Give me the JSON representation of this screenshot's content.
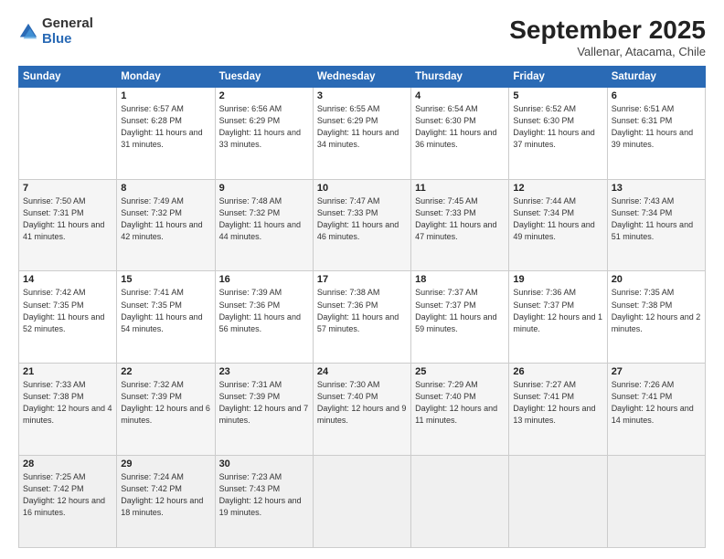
{
  "logo": {
    "general": "General",
    "blue": "Blue"
  },
  "title": "September 2025",
  "subtitle": "Vallenar, Atacama, Chile",
  "headers": [
    "Sunday",
    "Monday",
    "Tuesday",
    "Wednesday",
    "Thursday",
    "Friday",
    "Saturday"
  ],
  "weeks": [
    [
      {
        "day": "",
        "sunrise": "",
        "sunset": "",
        "daylight": ""
      },
      {
        "day": "1",
        "sunrise": "Sunrise: 6:57 AM",
        "sunset": "Sunset: 6:28 PM",
        "daylight": "Daylight: 11 hours and 31 minutes."
      },
      {
        "day": "2",
        "sunrise": "Sunrise: 6:56 AM",
        "sunset": "Sunset: 6:29 PM",
        "daylight": "Daylight: 11 hours and 33 minutes."
      },
      {
        "day": "3",
        "sunrise": "Sunrise: 6:55 AM",
        "sunset": "Sunset: 6:29 PM",
        "daylight": "Daylight: 11 hours and 34 minutes."
      },
      {
        "day": "4",
        "sunrise": "Sunrise: 6:54 AM",
        "sunset": "Sunset: 6:30 PM",
        "daylight": "Daylight: 11 hours and 36 minutes."
      },
      {
        "day": "5",
        "sunrise": "Sunrise: 6:52 AM",
        "sunset": "Sunset: 6:30 PM",
        "daylight": "Daylight: 11 hours and 37 minutes."
      },
      {
        "day": "6",
        "sunrise": "Sunrise: 6:51 AM",
        "sunset": "Sunset: 6:31 PM",
        "daylight": "Daylight: 11 hours and 39 minutes."
      }
    ],
    [
      {
        "day": "7",
        "sunrise": "Sunrise: 7:50 AM",
        "sunset": "Sunset: 7:31 PM",
        "daylight": "Daylight: 11 hours and 41 minutes."
      },
      {
        "day": "8",
        "sunrise": "Sunrise: 7:49 AM",
        "sunset": "Sunset: 7:32 PM",
        "daylight": "Daylight: 11 hours and 42 minutes."
      },
      {
        "day": "9",
        "sunrise": "Sunrise: 7:48 AM",
        "sunset": "Sunset: 7:32 PM",
        "daylight": "Daylight: 11 hours and 44 minutes."
      },
      {
        "day": "10",
        "sunrise": "Sunrise: 7:47 AM",
        "sunset": "Sunset: 7:33 PM",
        "daylight": "Daylight: 11 hours and 46 minutes."
      },
      {
        "day": "11",
        "sunrise": "Sunrise: 7:45 AM",
        "sunset": "Sunset: 7:33 PM",
        "daylight": "Daylight: 11 hours and 47 minutes."
      },
      {
        "day": "12",
        "sunrise": "Sunrise: 7:44 AM",
        "sunset": "Sunset: 7:34 PM",
        "daylight": "Daylight: 11 hours and 49 minutes."
      },
      {
        "day": "13",
        "sunrise": "Sunrise: 7:43 AM",
        "sunset": "Sunset: 7:34 PM",
        "daylight": "Daylight: 11 hours and 51 minutes."
      }
    ],
    [
      {
        "day": "14",
        "sunrise": "Sunrise: 7:42 AM",
        "sunset": "Sunset: 7:35 PM",
        "daylight": "Daylight: 11 hours and 52 minutes."
      },
      {
        "day": "15",
        "sunrise": "Sunrise: 7:41 AM",
        "sunset": "Sunset: 7:35 PM",
        "daylight": "Daylight: 11 hours and 54 minutes."
      },
      {
        "day": "16",
        "sunrise": "Sunrise: 7:39 AM",
        "sunset": "Sunset: 7:36 PM",
        "daylight": "Daylight: 11 hours and 56 minutes."
      },
      {
        "day": "17",
        "sunrise": "Sunrise: 7:38 AM",
        "sunset": "Sunset: 7:36 PM",
        "daylight": "Daylight: 11 hours and 57 minutes."
      },
      {
        "day": "18",
        "sunrise": "Sunrise: 7:37 AM",
        "sunset": "Sunset: 7:37 PM",
        "daylight": "Daylight: 11 hours and 59 minutes."
      },
      {
        "day": "19",
        "sunrise": "Sunrise: 7:36 AM",
        "sunset": "Sunset: 7:37 PM",
        "daylight": "Daylight: 12 hours and 1 minute."
      },
      {
        "day": "20",
        "sunrise": "Sunrise: 7:35 AM",
        "sunset": "Sunset: 7:38 PM",
        "daylight": "Daylight: 12 hours and 2 minutes."
      }
    ],
    [
      {
        "day": "21",
        "sunrise": "Sunrise: 7:33 AM",
        "sunset": "Sunset: 7:38 PM",
        "daylight": "Daylight: 12 hours and 4 minutes."
      },
      {
        "day": "22",
        "sunrise": "Sunrise: 7:32 AM",
        "sunset": "Sunset: 7:39 PM",
        "daylight": "Daylight: 12 hours and 6 minutes."
      },
      {
        "day": "23",
        "sunrise": "Sunrise: 7:31 AM",
        "sunset": "Sunset: 7:39 PM",
        "daylight": "Daylight: 12 hours and 7 minutes."
      },
      {
        "day": "24",
        "sunrise": "Sunrise: 7:30 AM",
        "sunset": "Sunset: 7:40 PM",
        "daylight": "Daylight: 12 hours and 9 minutes."
      },
      {
        "day": "25",
        "sunrise": "Sunrise: 7:29 AM",
        "sunset": "Sunset: 7:40 PM",
        "daylight": "Daylight: 12 hours and 11 minutes."
      },
      {
        "day": "26",
        "sunrise": "Sunrise: 7:27 AM",
        "sunset": "Sunset: 7:41 PM",
        "daylight": "Daylight: 12 hours and 13 minutes."
      },
      {
        "day": "27",
        "sunrise": "Sunrise: 7:26 AM",
        "sunset": "Sunset: 7:41 PM",
        "daylight": "Daylight: 12 hours and 14 minutes."
      }
    ],
    [
      {
        "day": "28",
        "sunrise": "Sunrise: 7:25 AM",
        "sunset": "Sunset: 7:42 PM",
        "daylight": "Daylight: 12 hours and 16 minutes."
      },
      {
        "day": "29",
        "sunrise": "Sunrise: 7:24 AM",
        "sunset": "Sunset: 7:42 PM",
        "daylight": "Daylight: 12 hours and 18 minutes."
      },
      {
        "day": "30",
        "sunrise": "Sunrise: 7:23 AM",
        "sunset": "Sunset: 7:43 PM",
        "daylight": "Daylight: 12 hours and 19 minutes."
      },
      {
        "day": "",
        "sunrise": "",
        "sunset": "",
        "daylight": ""
      },
      {
        "day": "",
        "sunrise": "",
        "sunset": "",
        "daylight": ""
      },
      {
        "day": "",
        "sunrise": "",
        "sunset": "",
        "daylight": ""
      },
      {
        "day": "",
        "sunrise": "",
        "sunset": "",
        "daylight": ""
      }
    ]
  ]
}
